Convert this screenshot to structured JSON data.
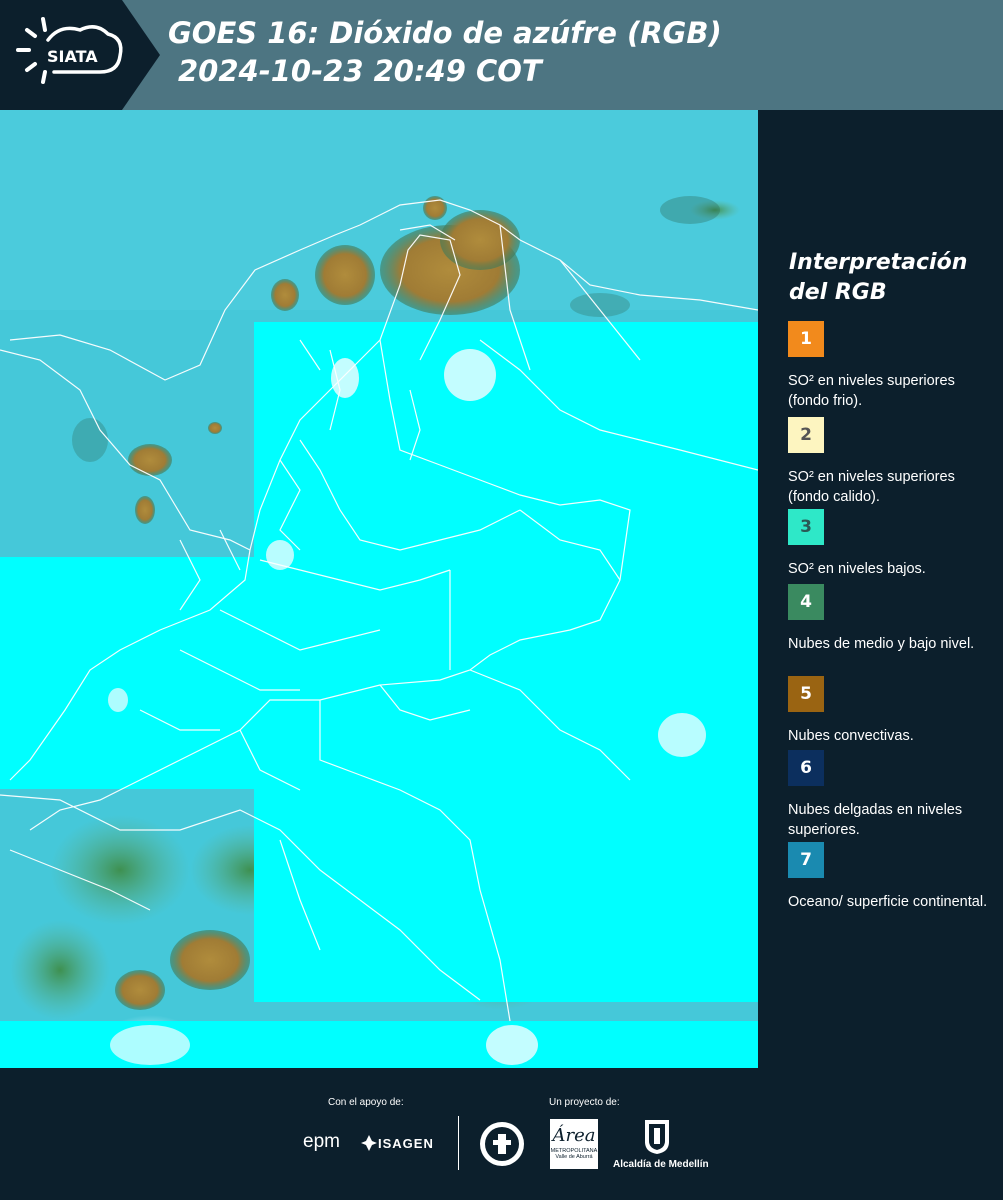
{
  "header": {
    "logo_text": "SIATA",
    "title_line1": "GOES 16: Dióxido de azúfre (RGB)",
    "title_line2": "2024-10-23 20:49 COT",
    "background_color": "#4d7582"
  },
  "legend": {
    "title_line1": "Interpretación",
    "title_line2": "del RGB",
    "items": [
      {
        "number": "1",
        "label": "SO² en niveles superiores (fondo frio).",
        "color": "#f28a1c",
        "text_color": "#ffffff"
      },
      {
        "number": "2",
        "label": "SO² en niveles superiores (fondo calido).",
        "color": "#fdf5c0",
        "text_color": "#555555"
      },
      {
        "number": "3",
        "label": "SO² en niveles bajos.",
        "color": "#2ee8c8",
        "text_color": "#2a5a55"
      },
      {
        "number": "4",
        "label": "Nubes de medio y bajo nivel.",
        "color": "#3a8a60",
        "text_color": "#ffffff"
      },
      {
        "number": "5",
        "label": "Nubes convectivas.",
        "color": "#9a6412",
        "text_color": "#ffffff"
      },
      {
        "number": "6",
        "label": "Nubes delgadas en niveles superiores.",
        "color": "#0c2f5e",
        "text_color": "#ffffff"
      },
      {
        "number": "7",
        "label": "Oceano/ superficie continental.",
        "color": "#1a8ab0",
        "text_color": "#ffffff"
      }
    ]
  },
  "footer": {
    "support_label": "Con el apoyo de:",
    "project_label": "Un proyecto de:",
    "logo_epm": "epm",
    "logo_isagen": "ISAGEN",
    "logo_area_main": "Área",
    "logo_area_sub1": "METROPOLITANA",
    "logo_area_sub2": "Valle de Aburrá",
    "logo_alcaldia": "Alcaldía de Medellín"
  },
  "map": {
    "no_data_color": "#00ffff",
    "ocean_color": "#45c8d9",
    "convective_color": "#a58a3c",
    "mid_cloud_color": "#4a9a5a"
  }
}
